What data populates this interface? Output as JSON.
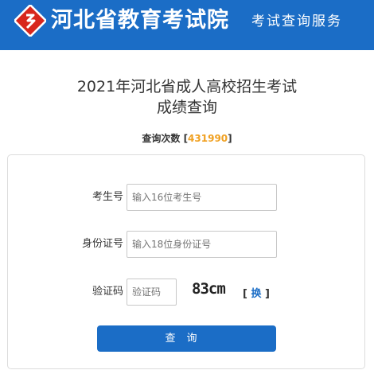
{
  "header": {
    "logo_icon": "hebei-exam-logo-icon",
    "title": "河北省教育考试院",
    "subtitle": "考试查询服务",
    "background_color": "#1b6dc6"
  },
  "page": {
    "title_line1": "2021年河北省成人高校招生考试",
    "title_line2": "成绩查询"
  },
  "counter": {
    "label": "查询次数",
    "open_bracket": "[",
    "value": "431990",
    "close_bracket": "]",
    "value_color": "#f0a020"
  },
  "form": {
    "exam_number": {
      "label": "考生号",
      "placeholder": "输入16位考生号",
      "value": ""
    },
    "id_number": {
      "label": "身份证号",
      "placeholder": "输入18位身份证号",
      "value": ""
    },
    "captcha": {
      "label": "验证码",
      "placeholder": "验证码",
      "value": "",
      "image_text": "83cm"
    },
    "refresh": {
      "open_bracket": "[",
      "label": "换",
      "close_bracket": "]"
    },
    "submit_label": "查询"
  }
}
